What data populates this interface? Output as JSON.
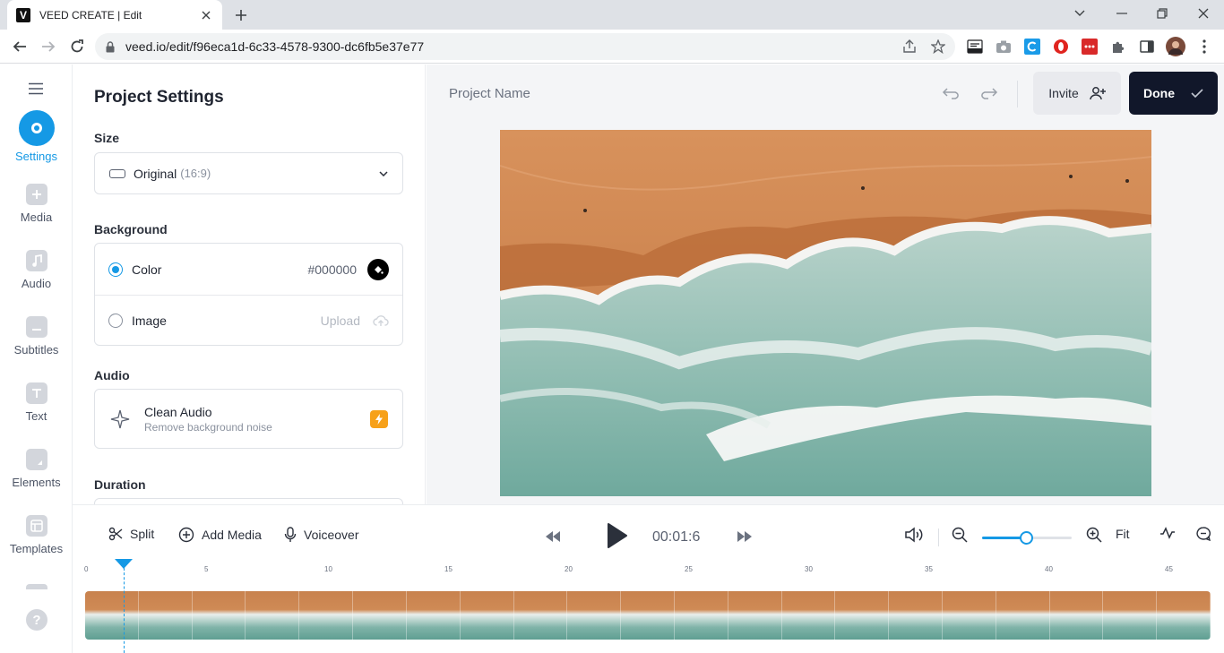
{
  "browser": {
    "tab_title": "VEED CREATE | Edit",
    "favicon_letter": "V",
    "url": "veed.io/edit/f96eca1d-6c33-4578-9300-dc6fb5e37e77"
  },
  "left_nav": {
    "items": [
      {
        "label": "Settings",
        "icon": "settings-icon",
        "active": true
      },
      {
        "label": "Media",
        "icon": "plus-icon"
      },
      {
        "label": "Audio",
        "icon": "music-note-icon"
      },
      {
        "label": "Subtitles",
        "icon": "subtitles-icon"
      },
      {
        "label": "Text",
        "icon": "text-icon"
      },
      {
        "label": "Elements",
        "icon": "elements-icon"
      },
      {
        "label": "Templates",
        "icon": "templates-icon"
      }
    ],
    "help_label": "?"
  },
  "settings": {
    "title": "Project Settings",
    "size_label": "Size",
    "size_value": "Original",
    "size_ratio": "(16:9)",
    "background_label": "Background",
    "color_option": "Color",
    "color_value": "#000000",
    "image_option": "Image",
    "upload_label": "Upload",
    "audio_label": "Audio",
    "clean_audio_title": "Clean Audio",
    "clean_audio_sub": "Remove background noise",
    "duration_label": "Duration"
  },
  "preview": {
    "project_name_placeholder": "Project Name",
    "invite_label": "Invite",
    "done_label": "Done"
  },
  "controls": {
    "split_label": "Split",
    "add_media_label": "Add Media",
    "voiceover_label": "Voiceover",
    "timecode": "00:01:6",
    "fit_label": "Fit",
    "zoom_level": 0.5
  },
  "timeline": {
    "ruler_labels": [
      "0",
      "5",
      "10",
      "15",
      "20",
      "25",
      "30",
      "35",
      "40",
      "45"
    ],
    "frame_count": 21
  },
  "colors": {
    "accent": "#1599e5",
    "done_bg": "#11172a",
    "sand": "#c8824e",
    "sea": "#7fb3a8"
  }
}
